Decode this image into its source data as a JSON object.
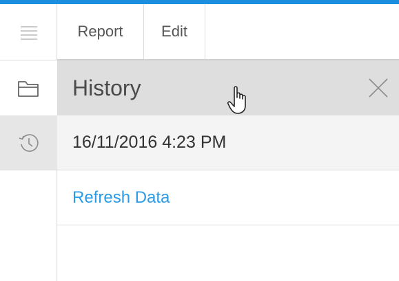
{
  "toolbar": {
    "tabs": [
      {
        "label": "Report"
      },
      {
        "label": "Edit"
      }
    ]
  },
  "rail": {
    "icons": [
      "hamburger-menu-icon",
      "folder-icon",
      "history-icon"
    ]
  },
  "panel": {
    "title": "History",
    "close_icon": "close-icon",
    "entries": [
      {
        "timestamp": "16/11/2016 4:23 PM"
      }
    ],
    "action_label": "Refresh Data"
  },
  "colors": {
    "accent": "#1b8ee0",
    "link": "#2a9be6",
    "header_bg": "#dedede",
    "active_rail_bg": "#e6e6e6"
  }
}
